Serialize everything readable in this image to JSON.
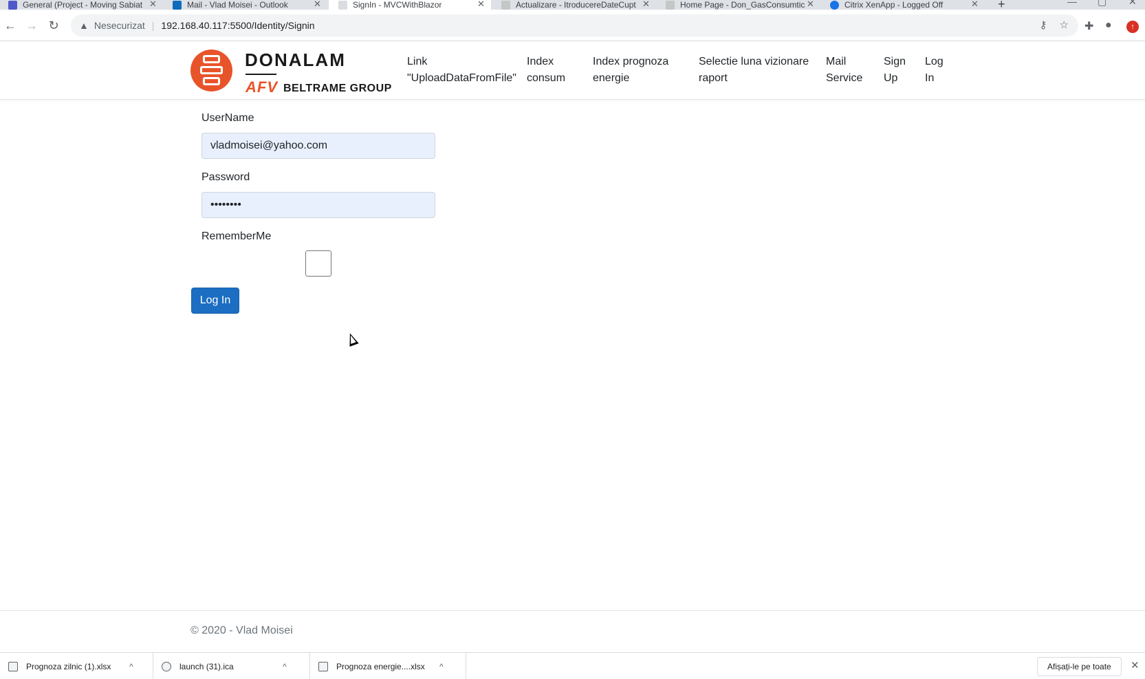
{
  "browser": {
    "tabs": [
      {
        "title": "General (Project - Moving Sabiat",
        "icon_color": "#5059c9"
      },
      {
        "title": "Mail - Vlad Moisei - Outlook",
        "icon_color": "#0f6cbd"
      },
      {
        "title": "SignIn - MVCWithBlazor",
        "icon_color": "#9aa0a6"
      },
      {
        "title": "Actualizare - ItroducereDateCupt",
        "icon_color": "#9aa0a6"
      },
      {
        "title": "Home Page - Don_GasConsumtic",
        "icon_color": "#9aa0a6"
      },
      {
        "title": "Citrix XenApp - Logged Off",
        "icon_color": "#1a73e8"
      }
    ],
    "address": {
      "security_label": "Nesecurizat",
      "url": "192.168.40.117:5500/Identity/Signin"
    }
  },
  "brand": {
    "name": "DONALAM",
    "afv": "AFV",
    "group": "BELTRAME GROUP",
    "accent_color": "#e8542a"
  },
  "nav": {
    "upload_l1": "Link",
    "upload_l2": "\"UploadDataFromFile\"",
    "index_l1": "Index",
    "index_l2": "consum",
    "prognoza_l1": "Index prognoza",
    "prognoza_l2": "energie",
    "selectie_l1": "Selectie luna vizionare",
    "selectie_l2": "raport",
    "mail_l1": "Mail",
    "mail_l2": "Service",
    "signup_l1": "Sign",
    "signup_l2": "Up",
    "login_l1": "Log",
    "login_l2": "In"
  },
  "form": {
    "username_label": "UserName",
    "username_value": "vladmoisei@yahoo.com",
    "password_label": "Password",
    "password_value": "********",
    "remember_label": "RememberMe",
    "remember_checked": false,
    "submit_label": "Log In",
    "primary_color": "#1b6ec2"
  },
  "footer": {
    "text": "© 2020 - Vlad Moisei"
  },
  "downloads": {
    "items": [
      {
        "name": "Prognoza zilnic (1).xlsx"
      },
      {
        "name": "launch (31).ica"
      },
      {
        "name": "Prognoza energie....xlsx"
      }
    ],
    "show_all_label": "Afișați-le pe toate"
  }
}
